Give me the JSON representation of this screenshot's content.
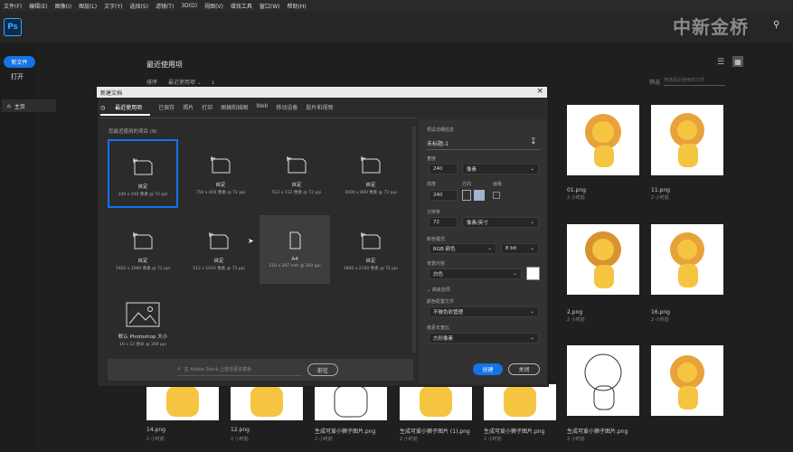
{
  "menu": [
    "文件(F)",
    "编辑(E)",
    "图像(I)",
    "图层(L)",
    "文字(Y)",
    "选择(S)",
    "滤镜(T)",
    "3D(D)",
    "视图(V)",
    "增效工具",
    "窗口(W)",
    "帮助(H)"
  ],
  "app_logo": "Ps",
  "watermark": "中新金桥",
  "sidebar": {
    "new_button": "新文件",
    "open": "打开",
    "home": "主页"
  },
  "home": {
    "title": "最近使用项",
    "sort_label": "排序",
    "sort_value": "最近使用项",
    "filter_label": "筛选",
    "filter_placeholder": "筛选最近使用的文件",
    "files": [
      {
        "name": "01.png",
        "date": "2 小时前"
      },
      {
        "name": "11.png",
        "date": "2 小时前"
      },
      {
        "name": "2.png",
        "date": "2 小时前"
      },
      {
        "name": "16.png",
        "date": "2 小时前"
      },
      {
        "name": "14.png",
        "date": "2 小时前"
      },
      {
        "name": "12.png",
        "date": "2 小时前"
      },
      {
        "name": "生成可爱小狮子图片.png",
        "date": "2 小时前"
      },
      {
        "name": "生成可爱小狮子图片 (1).png",
        "date": "2 小时前"
      },
      {
        "name": "生成可爱小狮子图片.png",
        "date": "2 小时前"
      },
      {
        "name": "生成可爱小狮子图片.png",
        "date": "2 小时前"
      }
    ]
  },
  "dialog": {
    "title": "新建文档",
    "tabs": [
      "最近使用项",
      "已保存",
      "照片",
      "打印",
      "图稿和插图",
      "Web",
      "移动设备",
      "胶片和视频"
    ],
    "section_header": "您最近使用的项目 (9)",
    "presets": [
      {
        "label": "自定",
        "desc": "240 x 240 像素 @ 72 ppi"
      },
      {
        "label": "自定",
        "desc": "750 x 400 像素 @ 72 ppi"
      },
      {
        "label": "自定",
        "desc": "512 x 512 像素 @ 72 ppi"
      },
      {
        "label": "自定",
        "desc": "3000 x 800 像素 @ 72 ppi"
      },
      {
        "label": "自定",
        "desc": "1920 x 1080 像素 @ 72 ppi"
      },
      {
        "label": "自定",
        "desc": "512 x 1024 像素 @ 72 ppi"
      },
      {
        "label": "A4",
        "desc": "210 x 297 mm @ 300 ppi"
      },
      {
        "label": "自定",
        "desc": "3840 x 2160 像素 @ 72 ppi"
      },
      {
        "label": "默认 Photoshop 大小",
        "desc": "16 x 12 厘米 @ 300 ppi"
      }
    ],
    "search_placeholder": "在 Adobe Stock 上查找更多模板",
    "go_button": "前往",
    "details": {
      "header": "预设详细信息",
      "name": "未标题-1",
      "width_label": "宽度",
      "width_value": "240",
      "width_unit": "像素",
      "height_label": "高度",
      "height_value": "240",
      "orientation_label": "方向",
      "artboard_label": "画板",
      "resolution_label": "分辨率",
      "resolution_value": "72",
      "resolution_unit": "像素/英寸",
      "color_mode_label": "颜色模式",
      "color_mode": "RGB 颜色",
      "bit_depth": "8 bit",
      "background_label": "背景内容",
      "background": "白色",
      "advanced_label": "高级选项",
      "profile_label": "颜色配置文件",
      "profile": "不做色彩管理",
      "pixel_ratio_label": "像素长宽比",
      "pixel_ratio": "方形像素"
    },
    "create_button": "创建",
    "close_button": "关闭"
  }
}
